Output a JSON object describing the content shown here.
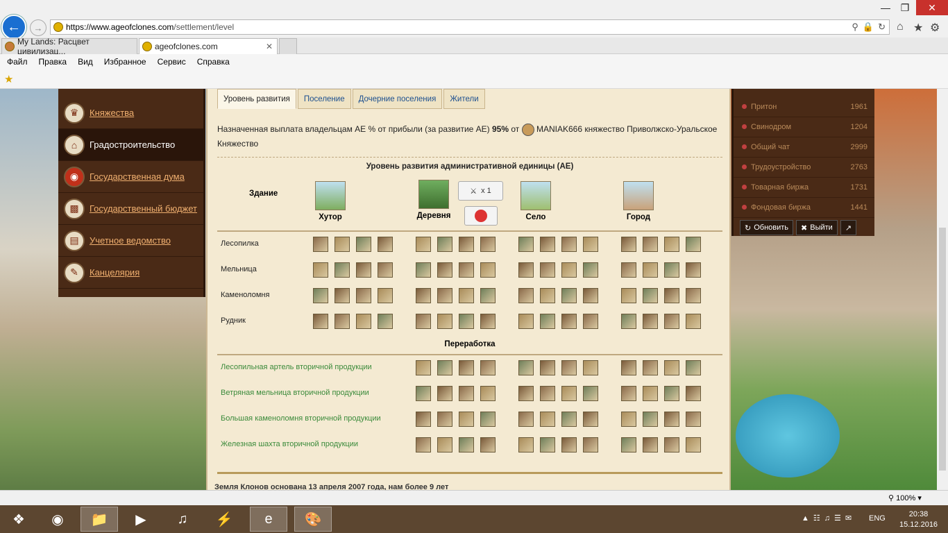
{
  "browser": {
    "url_host": "https://www.ageofclones.com",
    "url_path": "/settlement/level",
    "tabs": [
      {
        "label": "My Lands: Расцвет цивилизац..."
      },
      {
        "label": "ageofclones.com"
      }
    ],
    "menu": [
      "Файл",
      "Правка",
      "Вид",
      "Избранное",
      "Сервис",
      "Справка"
    ],
    "zoom": "100%"
  },
  "sidebar": {
    "items": [
      {
        "label": "Княжества",
        "icon": "castle-icon"
      },
      {
        "label": "Градостроительство",
        "icon": "town-icon",
        "active": true
      },
      {
        "label": "Государственная дума",
        "icon": "seal-icon"
      },
      {
        "label": "Государственный бюджет",
        "icon": "book-icon"
      },
      {
        "label": "Учетное ведомство",
        "icon": "scroll-icon"
      },
      {
        "label": "Канцелярия",
        "icon": "quill-icon"
      }
    ]
  },
  "content": {
    "tabs": [
      "Уровень развития",
      "Поселение",
      "Дочерние поселения",
      "Жители"
    ],
    "pay_text": "Назначенная выплата владельцам АЕ % от прибыли (за развитие АЕ)",
    "pay_percent": "95%",
    "pay_from": "от",
    "owner": "MANIAK666 княжество Приволжско-Уральское Княжество",
    "ae_title": "Уровень развития административной единицы (АЕ)",
    "building_header": "Здание",
    "levels": [
      "Хутор",
      "Деревня",
      "Село",
      "Город"
    ],
    "multiplier": "x 1",
    "buildings": [
      "Лесопилка",
      "Мельница",
      "Каменоломня",
      "Рудник"
    ],
    "processing_title": "Переработка",
    "processing": [
      "Лесопильная артель вторичной продукции",
      "Ветряная мельница вторичной продукции",
      "Большая каменоломня вторичной продукции",
      "Железная шахта вторичной продукции"
    ],
    "footer": "Земля Клонов основана 13 апреля 2007 года, нам более 9 лет"
  },
  "right_panel": {
    "items": [
      {
        "label": "Притон",
        "count": "1961"
      },
      {
        "label": "Свинодром",
        "count": "1204"
      },
      {
        "label": "Общий чат",
        "count": "2999"
      },
      {
        "label": "Трудоустройство",
        "count": "2763"
      },
      {
        "label": "Товарная биржа",
        "count": "1731"
      },
      {
        "label": "Фондовая биржа",
        "count": "1441"
      }
    ],
    "refresh": "Обновить",
    "logout": "Выйти"
  },
  "taskbar": {
    "lang": "ENG",
    "time": "20:38",
    "date": "15.12.2016"
  },
  "colors": {
    "accent_link": "#1c4f8f",
    "sidebar_link": "#f0b070",
    "green_link": "#3a8a3a"
  }
}
